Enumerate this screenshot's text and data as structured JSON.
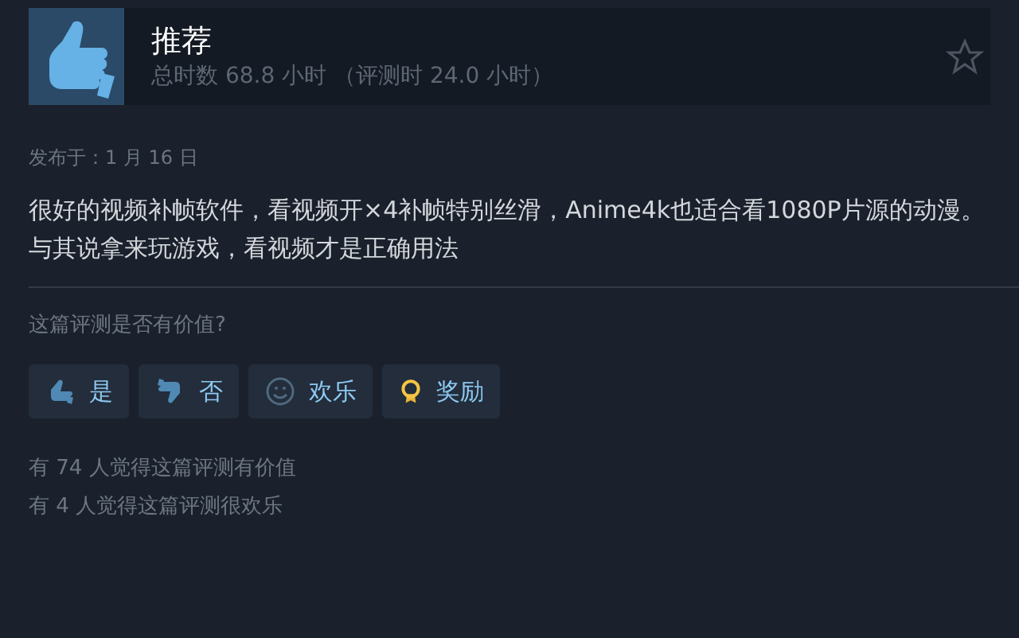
{
  "review": {
    "verdict": "推荐",
    "hours": "总时数 68.8 小时 （评测时 24.0 小时）",
    "posted": "发布于：1 月 16 日",
    "body": [
      "很好的视频补帧软件，看视频开×4补帧特别丝滑，Anime4k也适合看1080P片源的动漫。",
      "与其说拿来玩游戏，看视频才是正确用法"
    ]
  },
  "feedback": {
    "question": "这篇评测是否有价值?",
    "buttons": [
      {
        "kind": "yes",
        "label": "是"
      },
      {
        "kind": "no",
        "label": "否"
      },
      {
        "kind": "funny",
        "label": "欢乐"
      },
      {
        "kind": "award",
        "label": "奖励"
      }
    ],
    "counts": [
      "有 74 人觉得这篇评测有价值",
      "有 4 人觉得这篇评测很欢乐"
    ]
  }
}
